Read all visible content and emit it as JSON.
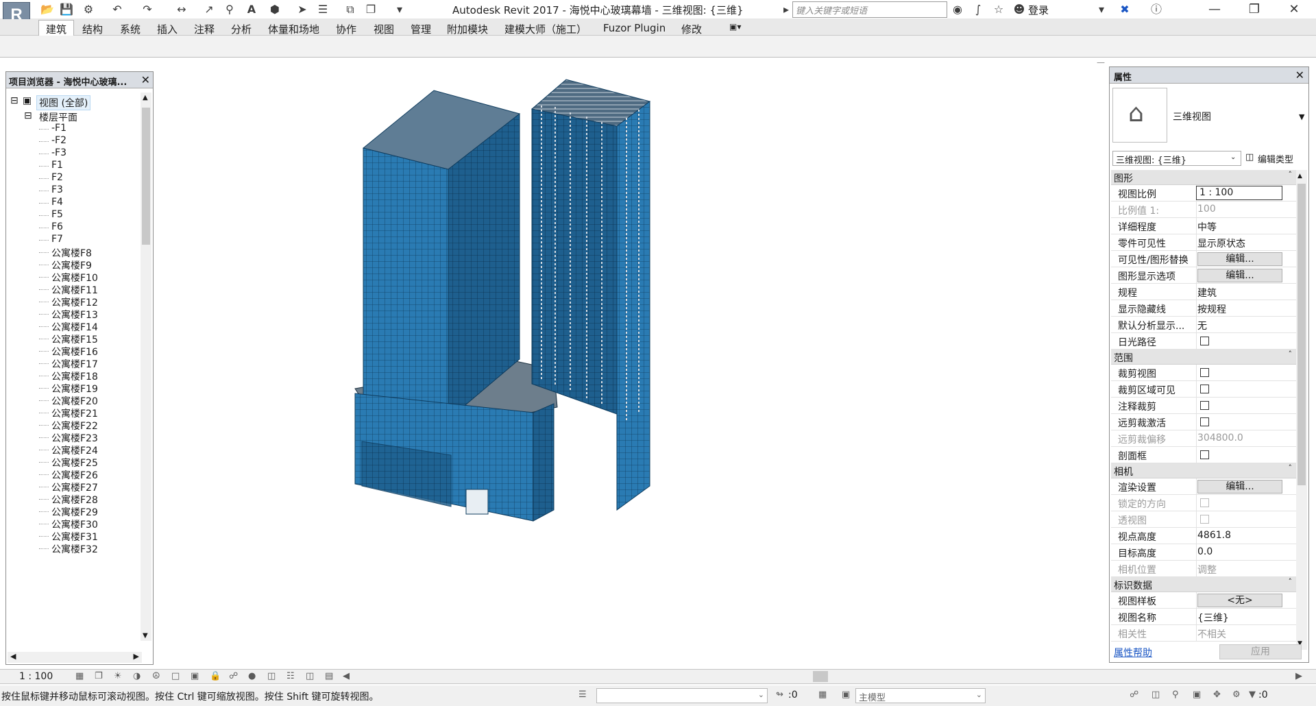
{
  "app": {
    "logo": "R",
    "title": "Autodesk Revit 2017 -    海悦中心玻璃幕墙 - 三维视图: {三维}"
  },
  "search": {
    "placeholder": "键入关键字或短语"
  },
  "account": {
    "login": "登录"
  },
  "quick_access_icons": [
    "open-icon",
    "save-icon",
    "sync-icon",
    "undo-icon",
    "redo-icon",
    "measure-icon",
    "align-dimension-icon",
    "tag-icon",
    "text-icon",
    "3d-view-icon",
    "section-icon",
    "thin-lines-icon",
    "close-hidden-icon",
    "switch-windows-icon",
    "customize-icon"
  ],
  "ribbon": {
    "tabs": [
      "建筑",
      "结构",
      "系统",
      "插入",
      "注释",
      "分析",
      "体量和场地",
      "协作",
      "视图",
      "管理",
      "附加模块",
      "建模大师（施工）",
      "Fuzor Plugin",
      "修改"
    ],
    "active": "建筑"
  },
  "browser": {
    "title": "项目浏览器 - 海悦中心玻璃...",
    "root": "视图 (全部)",
    "group": "楼层平面",
    "items": [
      "-F1",
      "-F2",
      "-F3",
      "F1",
      "F2",
      "F3",
      "F4",
      "F5",
      "F6",
      "F7",
      "公寓楼F8",
      "公寓楼F9",
      "公寓楼F10",
      "公寓楼F11",
      "公寓楼F12",
      "公寓楼F13",
      "公寓楼F14",
      "公寓楼F15",
      "公寓楼F16",
      "公寓楼F17",
      "公寓楼F18",
      "公寓楼F19",
      "公寓楼F20",
      "公寓楼F21",
      "公寓楼F22",
      "公寓楼F23",
      "公寓楼F24",
      "公寓楼F25",
      "公寓楼F26",
      "公寓楼F27",
      "公寓楼F28",
      "公寓楼F29",
      "公寓楼F30",
      "公寓楼F31",
      "公寓楼F32"
    ]
  },
  "properties": {
    "title": "属性",
    "type_name": "三维视图",
    "type_selector": "三维视图: {三维}",
    "edit_type": "编辑类型",
    "sections": {
      "graphics": "图形",
      "extents": "范围",
      "camera": "相机",
      "identity": "标识数据"
    },
    "rows": {
      "view_scale": {
        "k": "视图比例",
        "v": "1 : 100"
      },
      "scale_value": {
        "k": "比例值 1:",
        "v": "100"
      },
      "detail_level": {
        "k": "详细程度",
        "v": "中等"
      },
      "parts_visibility": {
        "k": "零件可见性",
        "v": "显示原状态"
      },
      "vg_overrides": {
        "k": "可见性/图形替换",
        "v": "编辑..."
      },
      "graphic_display": {
        "k": "图形显示选项",
        "v": "编辑..."
      },
      "discipline": {
        "k": "规程",
        "v": "建筑"
      },
      "hidden_lines": {
        "k": "显示隐藏线",
        "v": "按规程"
      },
      "analysis_display": {
        "k": "默认分析显示...",
        "v": "无"
      },
      "sun_path": {
        "k": "日光路径"
      },
      "crop_view": {
        "k": "裁剪视图"
      },
      "crop_visible": {
        "k": "裁剪区域可见"
      },
      "annotation_crop": {
        "k": "注释裁剪"
      },
      "far_clip_active": {
        "k": "远剪裁激活"
      },
      "far_clip_offset": {
        "k": "远剪裁偏移",
        "v": "304800.0"
      },
      "section_box": {
        "k": "剖面框"
      },
      "render_settings": {
        "k": "渲染设置",
        "v": "编辑..."
      },
      "locked_orientation": {
        "k": "锁定的方向"
      },
      "perspective": {
        "k": "透视图"
      },
      "eye_elevation": {
        "k": "视点高度",
        "v": "4861.8"
      },
      "target_elevation": {
        "k": "目标高度",
        "v": "0.0"
      },
      "camera_position": {
        "k": "相机位置",
        "v": "调整"
      },
      "view_template": {
        "k": "视图样板",
        "v": "<无>"
      },
      "view_name": {
        "k": "视图名称",
        "v": "{三维}"
      },
      "dependency": {
        "k": "相关性",
        "v": "不相关"
      }
    },
    "help": "属性帮助",
    "apply": "应用"
  },
  "viewbar": {
    "scale": "1 : 100"
  },
  "statusbar": {
    "hint": "按住鼠标键并移动鼠标可滚动视图。按住 Ctrl 键可缩放视图。按住 Shift 键可旋转视图。",
    "count": ":0",
    "model": "主模型",
    "filter_count": ":0"
  },
  "colors": {
    "glass_front": "#2a7bb3",
    "glass_side": "#1e5f8e",
    "glass_dark": "#0f3c5e",
    "link": "#1a56c4"
  }
}
